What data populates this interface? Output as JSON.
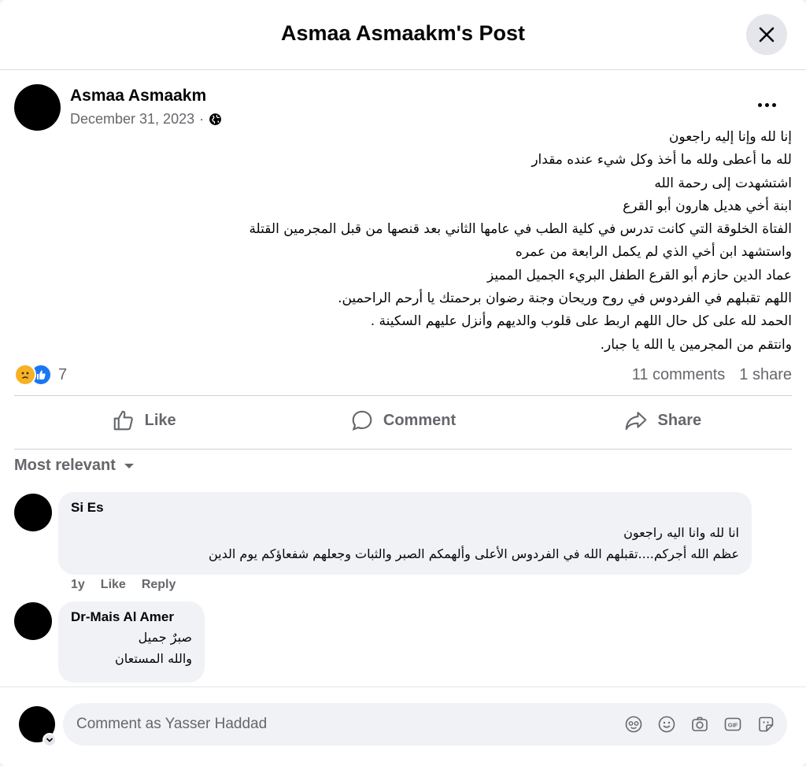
{
  "header": {
    "title": "Asmaa Asmaakm's Post"
  },
  "post": {
    "author": "Asmaa Asmaakm",
    "date": "December 31, 2023",
    "separator": "·",
    "lines": [
      "إنا لله وإنا إليه راجعون",
      "لله ما أعطى ولله ما أخذ وكل شيء عنده مقدار",
      "اشتشهدت إلى رحمة الله",
      "ابنة أخي هديل هارون أبو القرع",
      "الفتاة الخلوقة التي كانت تدرس في كلية الطب في عامها الثاني بعد قنصها من قبل المجرمين القتلة",
      "واستشهد ابن أخي الذي لم يكمل الرابعة من عمره",
      "عماد الدين حازم أبو القرع الطفل البريء الجميل المميز",
      "اللهم تقبلهم في الفردوس في روح وريحان وجنة رضوان برحمتك يا أرحم الراحمين.",
      "الحمد لله على كل حال اللهم اربط على قلوب والديهم وأنزل عليهم السكينة .",
      "وانتقم من المجرمين يا الله يا جبار."
    ],
    "reaction_count": "7",
    "comments_count": "11 comments",
    "shares_count": "1 share"
  },
  "actions": {
    "like": "Like",
    "comment": "Comment",
    "share": "Share"
  },
  "sort": {
    "label": "Most relevant"
  },
  "comments": [
    {
      "author": "Si Es",
      "lines": [
        "انا لله وانا اليه راجعون",
        "عظم الله أجركم....تقبلهم الله في الفردوس الأعلى وألهمكم الصبر والثبات وجعلهم شفعاؤكم يوم الدين"
      ],
      "age": "1y",
      "like": "Like",
      "reply": "Reply"
    },
    {
      "author": "Dr-Mais Al Amer",
      "lines": [
        "صبرٌ جميل",
        "والله المستعان"
      ]
    }
  ],
  "composer": {
    "placeholder": "Comment as Yasser Haddad"
  },
  "colors": {
    "accent": "#1877f2",
    "secondary_text": "#65676b",
    "bubble": "#f0f2f5"
  }
}
